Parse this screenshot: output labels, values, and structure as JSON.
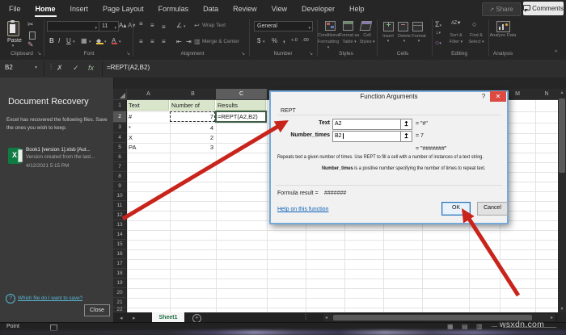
{
  "ribbon": {
    "tabs": [
      "File",
      "Home",
      "Insert",
      "Page Layout",
      "Formulas",
      "Data",
      "Review",
      "View",
      "Developer",
      "Help"
    ],
    "active_tab_index": 1,
    "share_label": "Share",
    "comments_label": "Comments",
    "group_labels": [
      "Clipboard",
      "Font",
      "Alignment",
      "Number",
      "Styles",
      "Cells",
      "Editing",
      "Analysis"
    ],
    "paste_label": "Paste",
    "font_size_value": "11",
    "wrap_text_label": "Wrap Text",
    "merge_center_label": "Merge & Center",
    "number_format_value": "General",
    "styles_buttons": [
      "Conditional Formatting",
      "Format as Table",
      "Cell Styles"
    ],
    "cells_buttons": [
      "Insert",
      "Delete",
      "Format"
    ],
    "editing_buttons": [
      "Sort & Filter",
      "Find & Select"
    ],
    "analysis_button": "Analyze Data"
  },
  "glyphs": {
    "dropdown": "▾",
    "cut": "✂",
    "painter": "✎",
    "bold": "B",
    "italic": "I",
    "underline": "U",
    "font_grow": "A▴",
    "font_shrink": "A▾",
    "borders": "▦",
    "fill": "◆",
    "font_color": "A",
    "align": "≡",
    "orientation": "∠",
    "wrap_icon": "↩",
    "merge_icon": "▥",
    "indent_left": "⇤",
    "indent_right": "⇥",
    "dollar": "$",
    "percent": "%",
    "comma": ",",
    "inc_decimal": "+.0",
    "dec_decimal": ".00",
    "sigma": "Σ",
    "fill_down": "↓",
    "clear": "◇",
    "sortaz": "AZ▼",
    "search": "○",
    "collapse_ribbon": "^",
    "share_icon": "↗",
    "cancel_entry": "✗",
    "confirm_entry": "✓",
    "fx": "fx",
    "name_arrow": "▼",
    "vdots": "⋮",
    "nav_left": "◂",
    "nav_right": "▸",
    "add_sheet": "+",
    "view_normal": "▦",
    "view_layout": "▤",
    "view_break": "▥",
    "zoom_minus": "—",
    "picker": "↥",
    "help": "?",
    "close_x": "✕",
    "question": "?",
    "scroll_up": "▴",
    "scroll_down": "▾",
    "scroll_left": "◂",
    "scroll_right": "▸"
  },
  "formula_bar": {
    "name_box": "B2",
    "formula": "=REPT(A2,B2)"
  },
  "recovery": {
    "title": "Document Recovery",
    "body": "Excel has recovered the following files. Save the ones you wish to keep.",
    "file_name": "Book1 [version 1].xlsb [Aut...",
    "file_desc": "Version created from the last...",
    "file_date": "4/12/2021 5:15 PM",
    "file_icon_letter": "X",
    "question_link": "Which file do I want to save?",
    "close_label": "Close"
  },
  "sheet": {
    "column_letters": [
      "A",
      "B",
      "C",
      "",
      "",
      "",
      "",
      "",
      "",
      "M",
      "N"
    ],
    "row_numbers": [
      "1",
      "2",
      "3",
      "4",
      "5",
      "6",
      "7",
      "8",
      "9",
      "10",
      "11",
      "12",
      "13",
      "14",
      "15",
      "16",
      "17",
      "18",
      "19",
      "20",
      "21",
      "22"
    ],
    "header_row": [
      "Text",
      "Number of times",
      "Results"
    ],
    "rows": [
      {
        "a": "#",
        "b": "7",
        "c": "=REPT(A2,B2)"
      },
      {
        "a": "*",
        "b": "4",
        "c": ""
      },
      {
        "a": "X",
        "b": "2",
        "c": ""
      },
      {
        "a": "PA",
        "b": "3",
        "c": ""
      }
    ],
    "tab_name": "Sheet1"
  },
  "dialog": {
    "title": "Function Arguments",
    "function_name": "REPT",
    "fields": [
      {
        "label": "Text",
        "value": "A2",
        "result": "=  \"#\""
      },
      {
        "label": "Number_times",
        "value": "B2",
        "result": "=  7"
      }
    ],
    "combined_result": "=  \"#######\"",
    "description": "Repeats text a given number of times. Use REPT to fill a cell with a number of instances of a text string.",
    "arg_help_bold": "Number_times",
    "arg_help_rest": " is a positive number specifying the number of times to repeat text.",
    "formula_result_label": "Formula result =",
    "formula_result_value": "#######",
    "help_link": "Help on this function",
    "ok_label": "OK",
    "cancel_label": "Cancel"
  },
  "status": {
    "mode": "Point",
    "watermark": "wsxdn.com"
  },
  "colors": {
    "arrow_red": "#c9241b",
    "excel_green": "#107c41",
    "header_green": "#d9e6cb",
    "dialog_frame": "#74a9da"
  }
}
